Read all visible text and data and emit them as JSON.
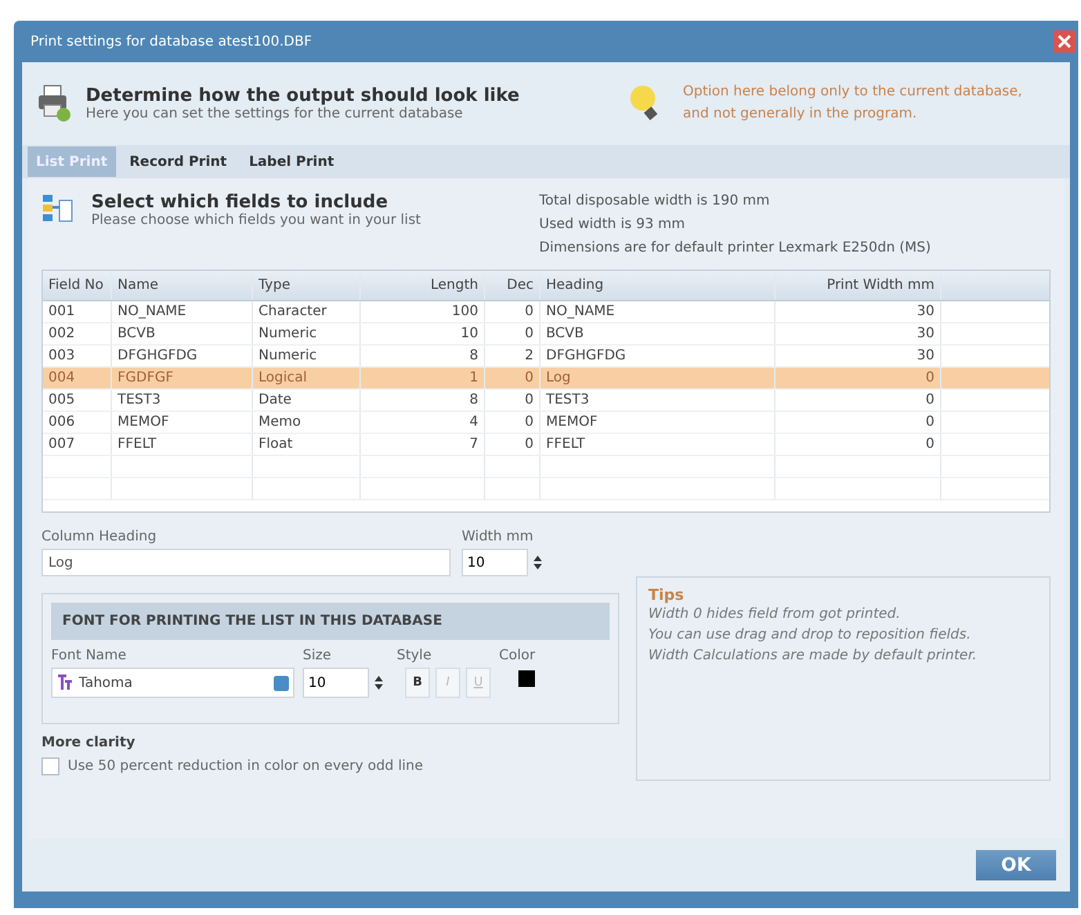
{
  "window": {
    "title": "Print settings for database atest100.DBF"
  },
  "header": {
    "title": "Determine how the output should look like",
    "subtitle": "Here you can set the settings for the current database",
    "note": [
      "Option here belong only to the current database,",
      "and not generally in the program."
    ]
  },
  "tabs": [
    {
      "label": "List Print",
      "selected": true
    },
    {
      "label": "Record Print",
      "selected": false
    },
    {
      "label": "Label Print",
      "selected": false
    }
  ],
  "fields_section": {
    "title": "Select which fields to include",
    "subtitle": "Please choose which fields you want in your list",
    "info": [
      "Total disposable width is 190 mm",
      "Used width is 93 mm",
      "Dimensions are for default printer Lexmark E250dn (MS)"
    ]
  },
  "table": {
    "columns": [
      "Field No",
      "Name",
      "Type",
      "Length",
      "Dec",
      "Heading",
      "Print Width mm"
    ],
    "rows": [
      {
        "cells": [
          "001",
          "NO_NAME",
          "Character",
          "100",
          "0",
          "NO_NAME",
          "30"
        ],
        "selected": false
      },
      {
        "cells": [
          "002",
          "BCVB",
          "Numeric",
          "10",
          "0",
          "BCVB",
          "30"
        ],
        "selected": false
      },
      {
        "cells": [
          "003",
          "DFGHGFDG",
          "Numeric",
          "8",
          "2",
          "DFGHGFDG",
          "30"
        ],
        "selected": false
      },
      {
        "cells": [
          "004",
          "FGDFGF",
          "Logical",
          "1",
          "0",
          "Log",
          "0"
        ],
        "selected": true
      },
      {
        "cells": [
          "005",
          "TEST3",
          "Date",
          "8",
          "0",
          "TEST3",
          "0"
        ],
        "selected": false
      },
      {
        "cells": [
          "006",
          "MEMOF",
          "Memo",
          "4",
          "0",
          "MEMOF",
          "0"
        ],
        "selected": false
      },
      {
        "cells": [
          "007",
          "FFELT",
          "Float",
          "7",
          "0",
          "FFELT",
          "0"
        ],
        "selected": false
      }
    ]
  },
  "column_heading": {
    "label": "Column Heading",
    "value": "Log"
  },
  "width": {
    "label": "Width mm",
    "value": "10"
  },
  "font_group": {
    "title": "FONT FOR PRINTING THE LIST IN THIS DATABASE",
    "font_name_label": "Font Name",
    "font_name": "Tahoma",
    "size_label": "Size",
    "size": "10",
    "style_label": "Style",
    "styles": [
      {
        "label": "B",
        "on": true
      },
      {
        "label": "I",
        "on": false
      },
      {
        "label": "U",
        "on": false
      }
    ],
    "color_label": "Color",
    "color": "#000000"
  },
  "more_clarity": {
    "title": "More clarity",
    "label": "Use 50 percent reduction in color on every odd line",
    "checked": false
  },
  "tips": {
    "title": "Tips",
    "lines": [
      "Width 0 hides field from got printed.",
      "You can use drag and drop to reposition fields.",
      "Width Calculations are made by default printer."
    ]
  },
  "buttons": [
    "OK"
  ]
}
